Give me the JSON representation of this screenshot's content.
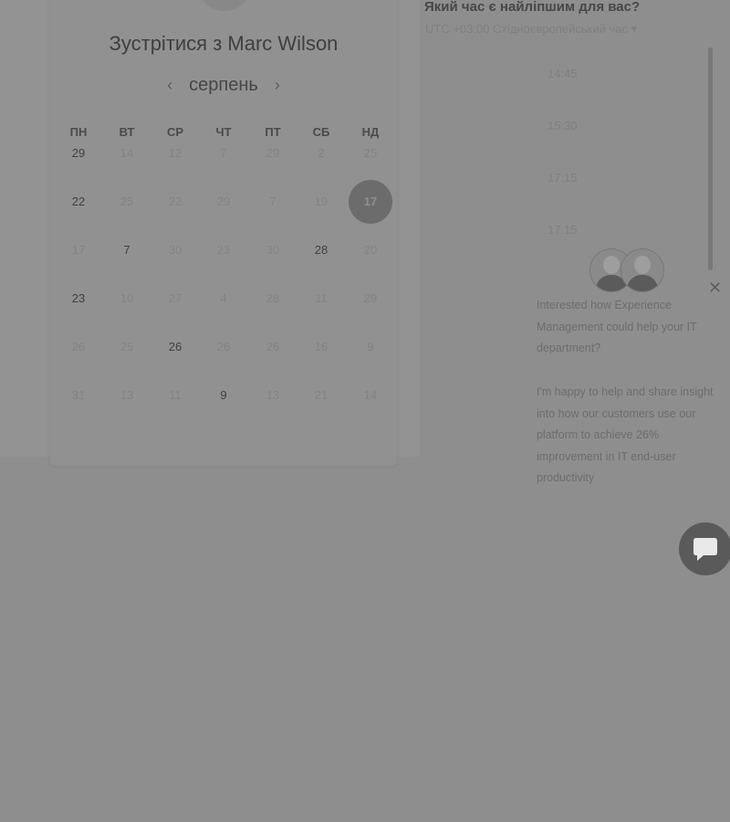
{
  "header": {
    "meet_title": "Зустрітися з Marc Wilson",
    "month": "серпень",
    "prev_icon": "chevron-left-icon",
    "next_icon": "chevron-right-icon"
  },
  "calendar": {
    "weekdays": [
      "ПН",
      "ВТ",
      "СР",
      "ЧТ",
      "ПТ",
      "СБ",
      "НД"
    ],
    "weeks": [
      [
        {
          "d": "29",
          "a": true
        },
        {
          "d": "14",
          "a": false
        },
        {
          "d": "12",
          "a": false
        },
        {
          "d": "7",
          "a": false
        },
        {
          "d": "29",
          "a": false
        },
        {
          "d": "2",
          "a": false
        },
        {
          "d": "25",
          "a": false
        }
      ],
      [
        {
          "d": "22",
          "a": true
        },
        {
          "d": "25",
          "a": false
        },
        {
          "d": "22",
          "a": false
        },
        {
          "d": "29",
          "a": false
        },
        {
          "d": "7",
          "a": false
        },
        {
          "d": "19",
          "a": false
        },
        {
          "d": "17",
          "a": true,
          "sel": true
        }
      ],
      [
        {
          "d": "17",
          "a": false
        },
        {
          "d": "7",
          "a": true
        },
        {
          "d": "30",
          "a": false
        },
        {
          "d": "23",
          "a": false
        },
        {
          "d": "30",
          "a": false
        },
        {
          "d": "28",
          "a": true
        },
        {
          "d": "20",
          "a": false
        }
      ],
      [
        {
          "d": "23",
          "a": true
        },
        {
          "d": "10",
          "a": false
        },
        {
          "d": "27",
          "a": false
        },
        {
          "d": "4",
          "a": false
        },
        {
          "d": "28",
          "a": false
        },
        {
          "d": "11",
          "a": false
        },
        {
          "d": "29",
          "a": false
        }
      ],
      [
        {
          "d": "26",
          "a": false
        },
        {
          "d": "25",
          "a": false
        },
        {
          "d": "26",
          "a": true
        },
        {
          "d": "26",
          "a": false
        },
        {
          "d": "26",
          "a": false
        },
        {
          "d": "16",
          "a": false
        },
        {
          "d": "9",
          "a": false
        }
      ],
      [
        {
          "d": "31",
          "a": false
        },
        {
          "d": "13",
          "a": false
        },
        {
          "d": "11",
          "a": false
        },
        {
          "d": "9",
          "a": true
        },
        {
          "d": "13",
          "a": false
        },
        {
          "d": "21",
          "a": false
        },
        {
          "d": "14",
          "a": false
        }
      ]
    ]
  },
  "times": {
    "question": "Який час є найліпшим для вас?",
    "timezone": "UTC +03:00 Східноєвропейський час ▾",
    "slots": [
      "14:45",
      "15:30",
      "17:15",
      "17:15"
    ]
  },
  "chat": {
    "message1": "Interested how Experience Management could help your IT department?",
    "message2": "I'm happy to help and share insight into how our customers use our platform to achieve 26% improvement in IT end-user productivity",
    "close_icon": "close-icon",
    "launcher_icon": "chat-bubble-icon"
  }
}
